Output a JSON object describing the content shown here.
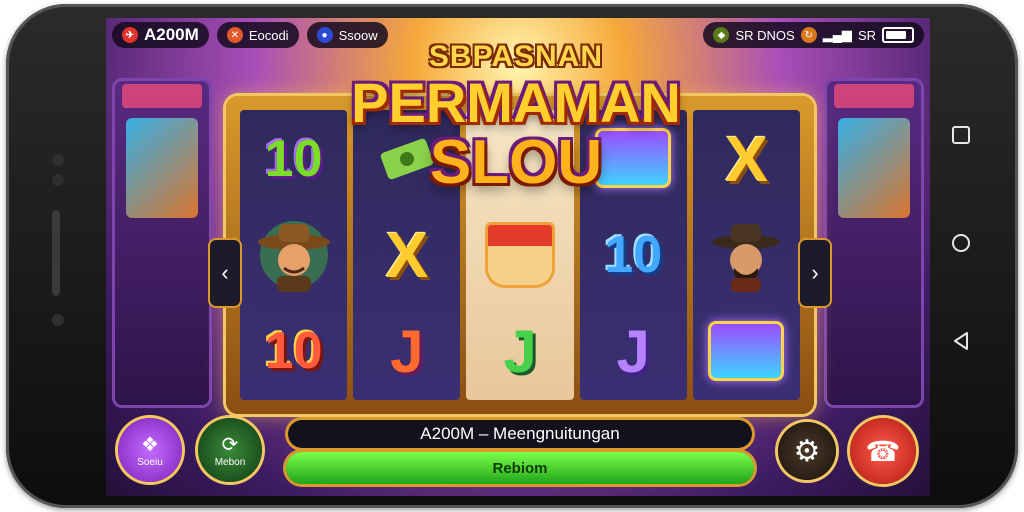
{
  "status": {
    "balance": "A200M",
    "pill2": "Eocodi",
    "pill3": "Ssoow",
    "right_text": "SR DNOS",
    "signal_text": "SR"
  },
  "logo": {
    "line1": "SBPASNAN",
    "line2": "PERMAMAN",
    "line3": "SLOU"
  },
  "reels": [
    [
      "10",
      "cowboy",
      "10"
    ],
    [
      "bill",
      "X",
      "J"
    ],
    [
      "",
      "bowl",
      "J"
    ],
    [
      "chest",
      "10",
      "J"
    ],
    [
      "X",
      "bandit",
      "chest"
    ]
  ],
  "controls": {
    "left_button_label": "Soeiu",
    "second_button_label": "Mebon",
    "message": "A200M  –  Meengnuitungan",
    "spin_label": "Rebiom"
  },
  "colors": {
    "accent": "#d99a2b",
    "spin_green": "#3fcf2a",
    "purple_btn": "#9b3fd6",
    "red_btn": "#e0342a"
  }
}
